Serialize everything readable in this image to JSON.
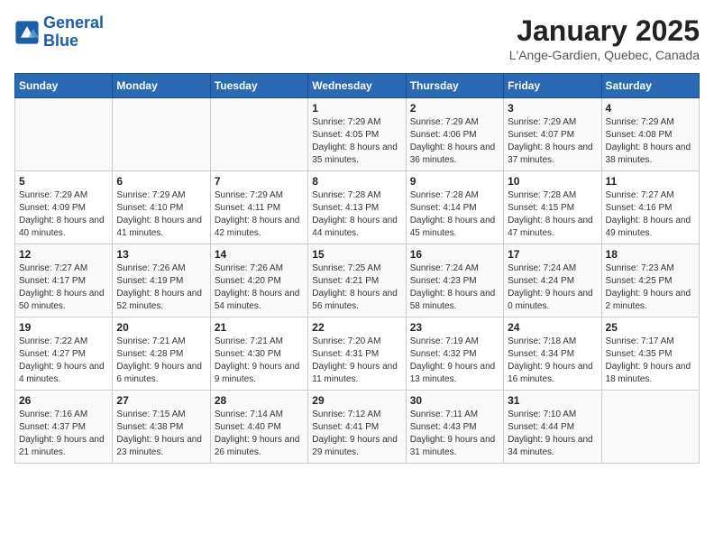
{
  "header": {
    "logo_line1": "General",
    "logo_line2": "Blue",
    "month": "January 2025",
    "location": "L'Ange-Gardien, Quebec, Canada"
  },
  "days_of_week": [
    "Sunday",
    "Monday",
    "Tuesday",
    "Wednesday",
    "Thursday",
    "Friday",
    "Saturday"
  ],
  "weeks": [
    [
      {
        "num": "",
        "info": ""
      },
      {
        "num": "",
        "info": ""
      },
      {
        "num": "",
        "info": ""
      },
      {
        "num": "1",
        "info": "Sunrise: 7:29 AM\nSunset: 4:05 PM\nDaylight: 8 hours and 35 minutes."
      },
      {
        "num": "2",
        "info": "Sunrise: 7:29 AM\nSunset: 4:06 PM\nDaylight: 8 hours and 36 minutes."
      },
      {
        "num": "3",
        "info": "Sunrise: 7:29 AM\nSunset: 4:07 PM\nDaylight: 8 hours and 37 minutes."
      },
      {
        "num": "4",
        "info": "Sunrise: 7:29 AM\nSunset: 4:08 PM\nDaylight: 8 hours and 38 minutes."
      }
    ],
    [
      {
        "num": "5",
        "info": "Sunrise: 7:29 AM\nSunset: 4:09 PM\nDaylight: 8 hours and 40 minutes."
      },
      {
        "num": "6",
        "info": "Sunrise: 7:29 AM\nSunset: 4:10 PM\nDaylight: 8 hours and 41 minutes."
      },
      {
        "num": "7",
        "info": "Sunrise: 7:29 AM\nSunset: 4:11 PM\nDaylight: 8 hours and 42 minutes."
      },
      {
        "num": "8",
        "info": "Sunrise: 7:28 AM\nSunset: 4:13 PM\nDaylight: 8 hours and 44 minutes."
      },
      {
        "num": "9",
        "info": "Sunrise: 7:28 AM\nSunset: 4:14 PM\nDaylight: 8 hours and 45 minutes."
      },
      {
        "num": "10",
        "info": "Sunrise: 7:28 AM\nSunset: 4:15 PM\nDaylight: 8 hours and 47 minutes."
      },
      {
        "num": "11",
        "info": "Sunrise: 7:27 AM\nSunset: 4:16 PM\nDaylight: 8 hours and 49 minutes."
      }
    ],
    [
      {
        "num": "12",
        "info": "Sunrise: 7:27 AM\nSunset: 4:17 PM\nDaylight: 8 hours and 50 minutes."
      },
      {
        "num": "13",
        "info": "Sunrise: 7:26 AM\nSunset: 4:19 PM\nDaylight: 8 hours and 52 minutes."
      },
      {
        "num": "14",
        "info": "Sunrise: 7:26 AM\nSunset: 4:20 PM\nDaylight: 8 hours and 54 minutes."
      },
      {
        "num": "15",
        "info": "Sunrise: 7:25 AM\nSunset: 4:21 PM\nDaylight: 8 hours and 56 minutes."
      },
      {
        "num": "16",
        "info": "Sunrise: 7:24 AM\nSunset: 4:23 PM\nDaylight: 8 hours and 58 minutes."
      },
      {
        "num": "17",
        "info": "Sunrise: 7:24 AM\nSunset: 4:24 PM\nDaylight: 9 hours and 0 minutes."
      },
      {
        "num": "18",
        "info": "Sunrise: 7:23 AM\nSunset: 4:25 PM\nDaylight: 9 hours and 2 minutes."
      }
    ],
    [
      {
        "num": "19",
        "info": "Sunrise: 7:22 AM\nSunset: 4:27 PM\nDaylight: 9 hours and 4 minutes."
      },
      {
        "num": "20",
        "info": "Sunrise: 7:21 AM\nSunset: 4:28 PM\nDaylight: 9 hours and 6 minutes."
      },
      {
        "num": "21",
        "info": "Sunrise: 7:21 AM\nSunset: 4:30 PM\nDaylight: 9 hours and 9 minutes."
      },
      {
        "num": "22",
        "info": "Sunrise: 7:20 AM\nSunset: 4:31 PM\nDaylight: 9 hours and 11 minutes."
      },
      {
        "num": "23",
        "info": "Sunrise: 7:19 AM\nSunset: 4:32 PM\nDaylight: 9 hours and 13 minutes."
      },
      {
        "num": "24",
        "info": "Sunrise: 7:18 AM\nSunset: 4:34 PM\nDaylight: 9 hours and 16 minutes."
      },
      {
        "num": "25",
        "info": "Sunrise: 7:17 AM\nSunset: 4:35 PM\nDaylight: 9 hours and 18 minutes."
      }
    ],
    [
      {
        "num": "26",
        "info": "Sunrise: 7:16 AM\nSunset: 4:37 PM\nDaylight: 9 hours and 21 minutes."
      },
      {
        "num": "27",
        "info": "Sunrise: 7:15 AM\nSunset: 4:38 PM\nDaylight: 9 hours and 23 minutes."
      },
      {
        "num": "28",
        "info": "Sunrise: 7:14 AM\nSunset: 4:40 PM\nDaylight: 9 hours and 26 minutes."
      },
      {
        "num": "29",
        "info": "Sunrise: 7:12 AM\nSunset: 4:41 PM\nDaylight: 9 hours and 29 minutes."
      },
      {
        "num": "30",
        "info": "Sunrise: 7:11 AM\nSunset: 4:43 PM\nDaylight: 9 hours and 31 minutes."
      },
      {
        "num": "31",
        "info": "Sunrise: 7:10 AM\nSunset: 4:44 PM\nDaylight: 9 hours and 34 minutes."
      },
      {
        "num": "",
        "info": ""
      }
    ]
  ]
}
